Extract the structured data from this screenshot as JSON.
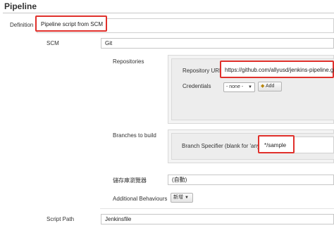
{
  "page": {
    "title": "Pipeline"
  },
  "definition": {
    "label": "Definition",
    "value": "Pipeline script from SCM"
  },
  "scm": {
    "label": "SCM",
    "value": "Git"
  },
  "repositories": {
    "label": "Repositories",
    "url_label": "Repository URL",
    "url_value": "https://github.com/allyusd/jenkins-pipeline.git",
    "credentials_label": "Credentials",
    "credentials_value": "- none -",
    "add_button": "Add"
  },
  "branches": {
    "label": "Branches to build",
    "specifier_label": "Branch Specifier (blank for 'any')",
    "specifier_value": "*/sample"
  },
  "repo_browser": {
    "label": "儲存庫瀏覽器",
    "value": "(自動)"
  },
  "additional_behaviours": {
    "label": "Additional Behaviours",
    "button": "新增"
  },
  "script_path": {
    "label": "Script Path",
    "value": "Jenkinsfile"
  }
}
